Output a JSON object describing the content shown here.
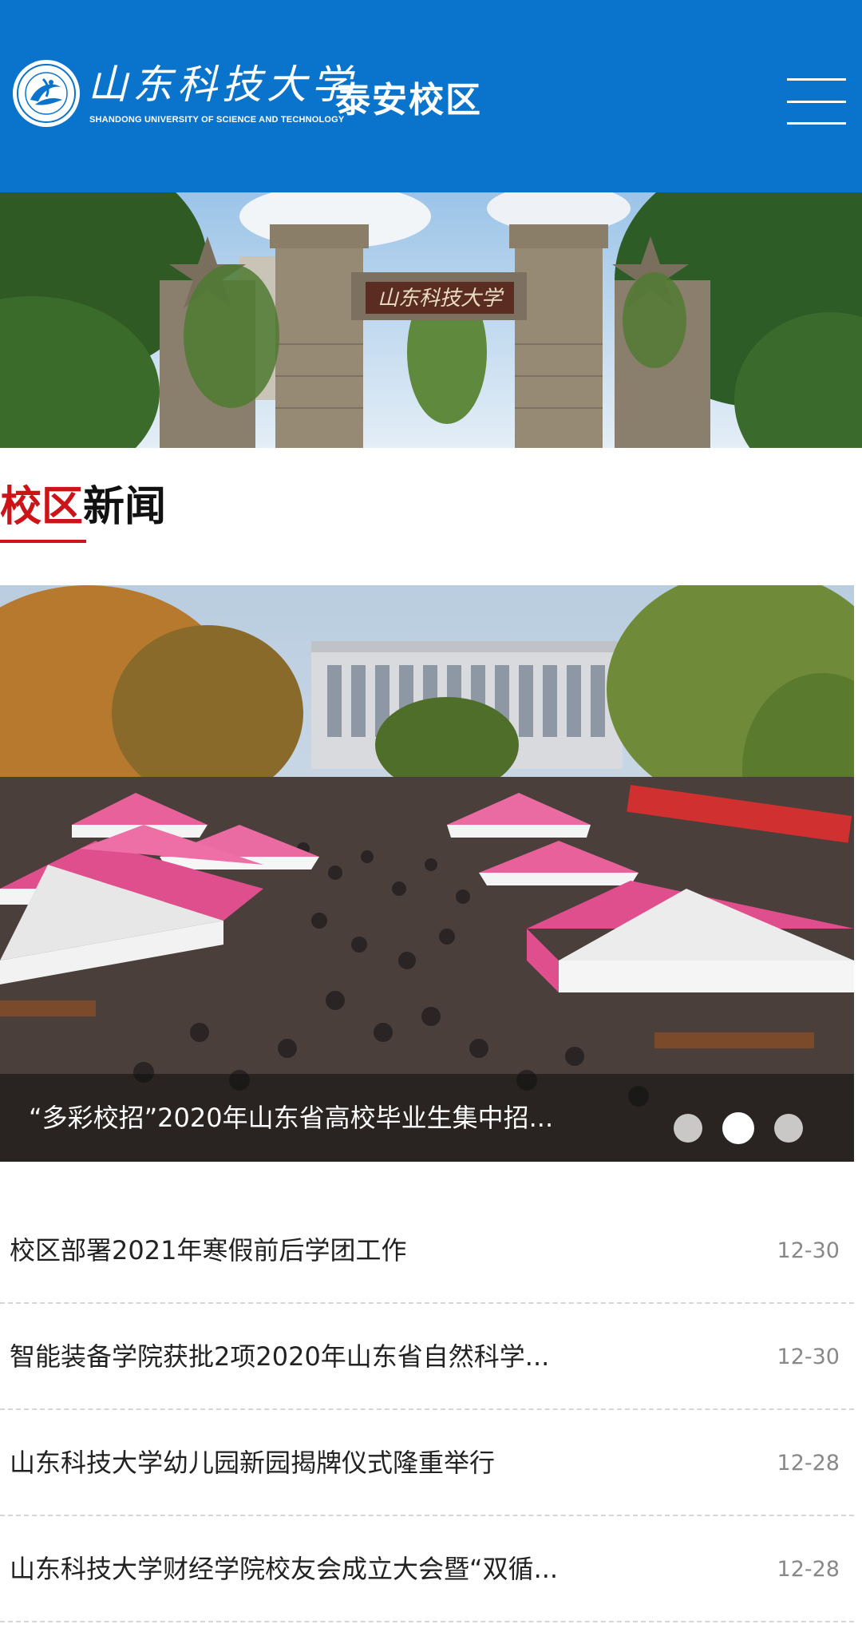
{
  "header": {
    "logo_script": "山东科技大学",
    "logo_english": "SHANDONG UNIVERSITY OF SCIENCE AND TECHNOLOGY",
    "campus_name": "泰安校区",
    "menu_icon": "hamburger-menu-icon",
    "background_color": "#0a74cc"
  },
  "banner": {
    "gate_inscription": "山东科技大学"
  },
  "section": {
    "title_accent": "校区",
    "title_rest": "新闻",
    "accent_color": "#cc1418"
  },
  "featured": {
    "caption": "“多彩校招”2020年山东省高校毕业生集中招...",
    "slide_count": 3,
    "active_slide": 2
  },
  "news": [
    {
      "title": "校区部署2021年寒假前后学团工作",
      "date": "12-30"
    },
    {
      "title": "智能装备学院获批2项2020年山东省自然科学...",
      "date": "12-30"
    },
    {
      "title": "山东科技大学幼儿园新园揭牌仪式隆重举行",
      "date": "12-28"
    },
    {
      "title": "山东科技大学财经学院校友会成立大会暨“双循...",
      "date": "12-28"
    }
  ]
}
